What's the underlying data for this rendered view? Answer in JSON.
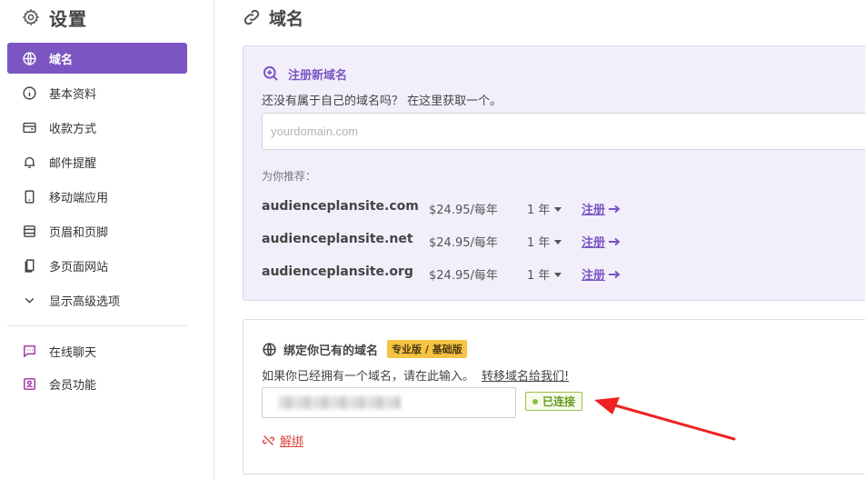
{
  "colors": {
    "accent": "#7b56c2",
    "badge": "#f6c344",
    "connected": "#8cbf3a",
    "danger": "#d9463e",
    "annotation": "#ee2222"
  },
  "sidebar": {
    "title": "设置",
    "items": [
      {
        "label": "域名",
        "icon": "globe-icon",
        "active": true
      },
      {
        "label": "基本资料",
        "icon": "info-icon"
      },
      {
        "label": "收款方式",
        "icon": "wallet-icon"
      },
      {
        "label": "邮件提醒",
        "icon": "bell-icon"
      },
      {
        "label": "移动端应用",
        "icon": "mobile-icon"
      },
      {
        "label": "页眉和页脚",
        "icon": "layout-icon"
      },
      {
        "label": "多页面网站",
        "icon": "pages-icon"
      },
      {
        "label": "显示高级选项",
        "icon": "chevron-down-icon"
      },
      {
        "label": "在线聊天",
        "icon": "chat-icon"
      },
      {
        "label": "会员功能",
        "icon": "member-icon"
      }
    ]
  },
  "main": {
    "title": "域名",
    "register": {
      "heading": "注册新域名",
      "description": "还没有属于自己的域名吗？ 在这里获取一个。",
      "placeholder": "yourdomain.com",
      "recommend_label": "为你推荐：",
      "suggestions": [
        {
          "domain": "audienceplansite.com",
          "price": "$24.95/每年",
          "term": "1 年",
          "action": "注册"
        },
        {
          "domain": "audienceplansite.net",
          "price": "$24.95/每年",
          "term": "1 年",
          "action": "注册"
        },
        {
          "domain": "audienceplansite.org",
          "price": "$24.95/每年",
          "term": "1 年",
          "action": "注册"
        }
      ]
    },
    "bind": {
      "heading": "绑定你已有的域名",
      "badge": "专业版 / 基础版",
      "description": "如果你已经拥有一个域名，请在此输入。",
      "transfer_link": "转移域名给我们!",
      "status": "已连接",
      "unbind": "解绑"
    }
  }
}
